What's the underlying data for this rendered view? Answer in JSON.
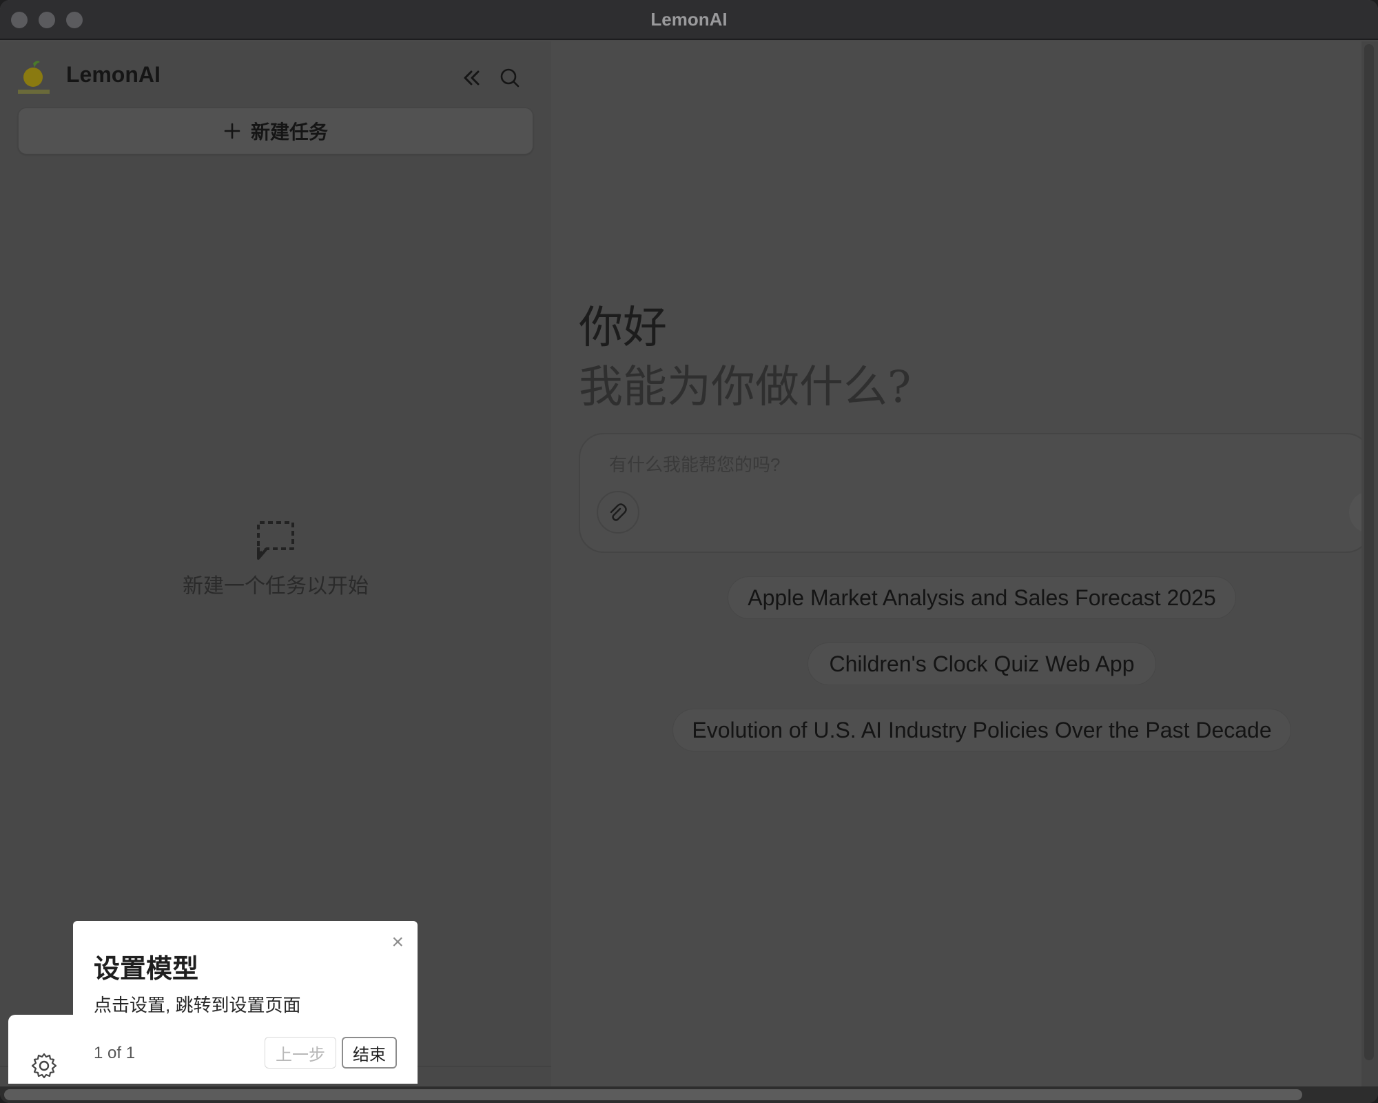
{
  "window": {
    "title": "LemonAI"
  },
  "sidebar": {
    "brand": "LemonAI",
    "logo_icon": "lemon-logo-icon",
    "new_task_label": "新建任务",
    "empty_text": "新建一个任务以开始"
  },
  "main": {
    "greeting_line1": "你好",
    "greeting_line2": "我能为你做什么?",
    "chat_placeholder": "有什么我能帮您的吗?",
    "suggestions": [
      "Apple Market Analysis and Sales Forecast 2025",
      "Children's Clock Quiz Web App",
      "Evolution of U.S. AI Industry Policies Over the Past Decade"
    ]
  },
  "tour": {
    "title": "设置模型",
    "description": "点击设置, 跳转到设置页面",
    "counter": "1 of 1",
    "prev_label": "上一步",
    "end_label": "结束",
    "close_glyph": "×"
  },
  "colors": {
    "overlay_bg": "#4a4a4a",
    "popover_bg": "#ffffff",
    "titlebar_bg": "#2e2e30"
  }
}
